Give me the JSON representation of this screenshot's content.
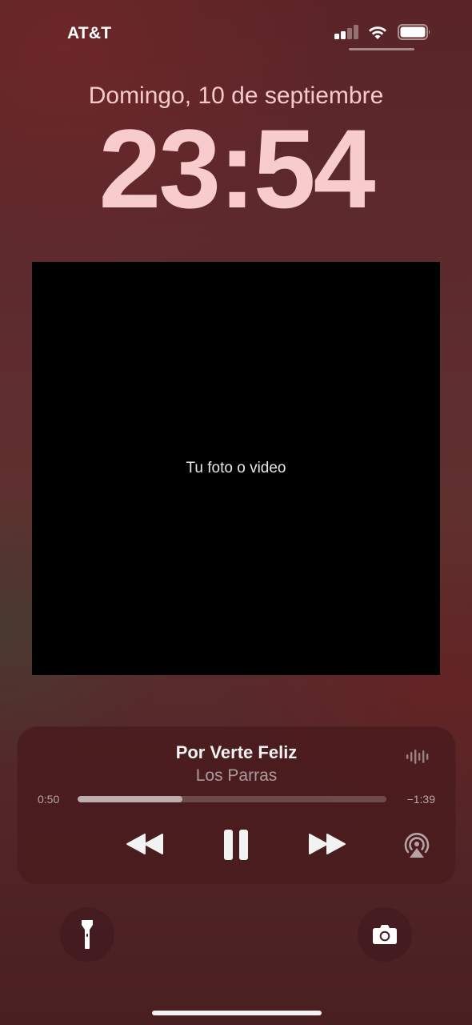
{
  "status_bar": {
    "carrier": "AT&T",
    "signal_bars": 2,
    "signal_icon": "cellular-signal-icon",
    "wifi_icon": "wifi-icon",
    "battery_icon": "battery-icon",
    "battery_level": 0.9
  },
  "lock_screen": {
    "date": "Domingo, 10 de septiembre",
    "time": "23:54"
  },
  "photo_widget": {
    "label": "Tu foto o video"
  },
  "now_playing": {
    "title": "Por Verte Feliz",
    "artist": "Los Parras",
    "elapsed": "0:50",
    "remaining": "−1:39",
    "progress": 0.34,
    "icons": {
      "waveform": "waveform-icon",
      "rewind": "rewind-icon",
      "pause": "pause-icon",
      "forward": "fast-forward-icon",
      "airplay": "airplay-icon"
    }
  },
  "quick_actions": {
    "left_icon": "flashlight-icon",
    "right_icon": "camera-icon"
  },
  "colors": {
    "accent_time": "#f8cccc",
    "background": "#5a2427",
    "player_bg": "#46191c"
  }
}
